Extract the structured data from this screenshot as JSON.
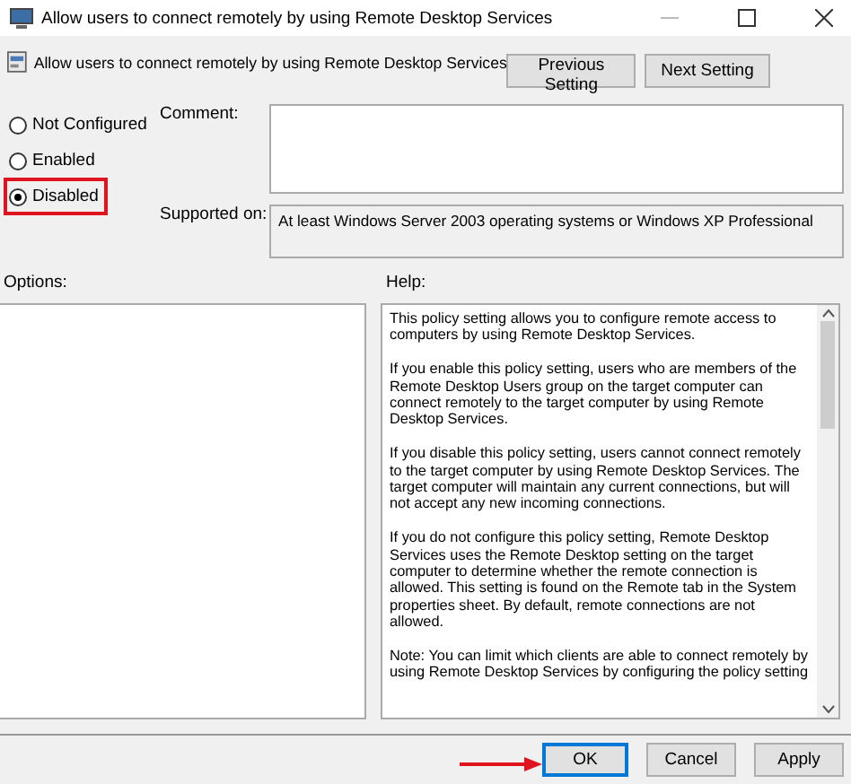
{
  "window": {
    "title": "Allow users to connect remotely by using Remote Desktop Services"
  },
  "header": {
    "setting_name": "Allow users to connect remotely by using Remote Desktop Services",
    "buttons": [
      {
        "label": "Previous Setting"
      },
      {
        "label": "Next Setting"
      }
    ]
  },
  "state_options": [
    {
      "label": "Not Configured",
      "selected": false
    },
    {
      "label": "Enabled",
      "selected": false
    },
    {
      "label": "Disabled",
      "selected": true
    }
  ],
  "comment": {
    "label": "Comment:"
  },
  "supported_on": {
    "label": "Supported on:",
    "value": "At least Windows Server 2003 operating systems or Windows XP Professional"
  },
  "options": {
    "label": "Options:"
  },
  "help": {
    "label": "Help:",
    "paragraphs": [
      "This policy setting allows you to configure remote access to computers by using Remote Desktop Services.",
      "If you enable this policy setting, users who are members of the Remote Desktop Users group on the target computer can connect remotely to the target computer by using Remote Desktop Services.",
      "If you disable this policy setting, users cannot connect remotely to the target computer by using Remote Desktop Services. The target computer will maintain any current connections, but will not accept any new incoming connections.",
      "If you do not configure this policy setting, Remote Desktop Services uses the Remote Desktop setting on the target computer to determine whether the remote connection is allowed. This setting is found on the Remote tab in the System properties sheet. By default, remote connections are not allowed.",
      "Note: You can limit which clients are able to connect remotely by using Remote Desktop Services by configuring the policy setting"
    ]
  },
  "buttons": [
    {
      "label": "OK",
      "default": true
    },
    {
      "label": "Cancel",
      "default": false
    },
    {
      "label": "Apply",
      "default": false
    }
  ]
}
